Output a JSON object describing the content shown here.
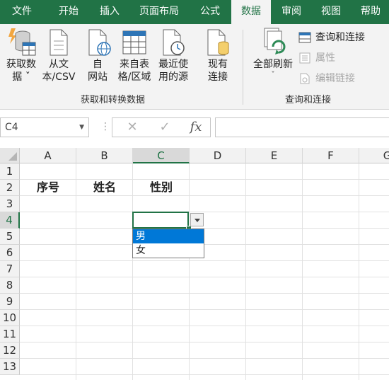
{
  "ribbon_tabs": [
    "文件",
    "开始",
    "插入",
    "页面布局",
    "公式",
    "数据",
    "审阅",
    "视图",
    "帮助"
  ],
  "active_tab": "数据",
  "accent": "#217346",
  "get_transform": {
    "buttons": [
      "获取数\n据 ˇ",
      "从文\n本/CSV",
      "自\n网站",
      "来自表\n格/区域",
      "最近使\n用的源",
      "现有\n连接"
    ],
    "group_label": "获取和转换数据"
  },
  "queries": {
    "refresh_all": "全部刷新",
    "refresh_all_arrow": "ˇ",
    "queries_connections": "查询和连接",
    "properties": "属性",
    "edit_links": "编辑链接",
    "group_label": "查询和连接"
  },
  "name_box": "C4",
  "formula_content": "",
  "columns": [
    "A",
    "B",
    "C",
    "D",
    "E",
    "F",
    "G"
  ],
  "rows": [
    "1",
    "2",
    "3",
    "4",
    "5",
    "6",
    "7",
    "8",
    "9",
    "10",
    "11",
    "12",
    "13"
  ],
  "cells": {
    "A2": "序号",
    "B2": "姓名",
    "C2": "性别"
  },
  "dropdown_options": [
    "男",
    "女"
  ],
  "dropdown_highlight_color": "#0078d7"
}
